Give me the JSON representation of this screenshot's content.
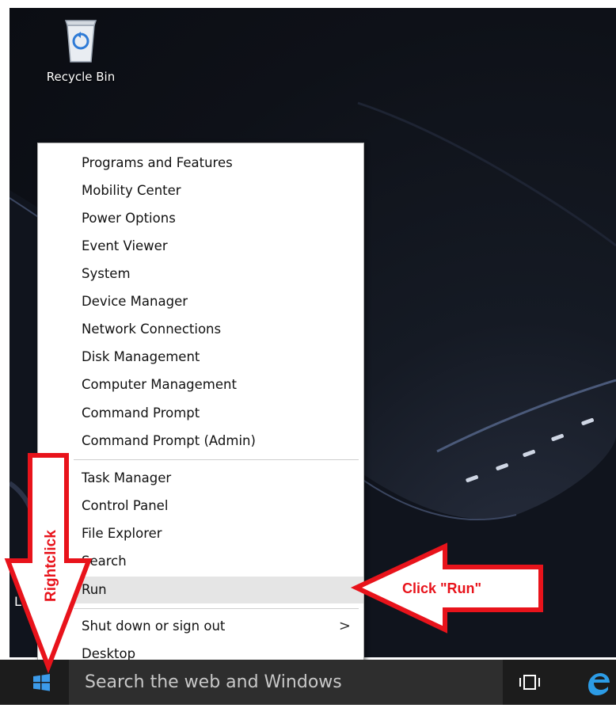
{
  "desktop": {
    "recycle_bin_label": "Recycle Bin",
    "partial_label": "Lo"
  },
  "context_menu": {
    "items": [
      "Programs and Features",
      "Mobility Center",
      "Power Options",
      "Event Viewer",
      "System",
      "Device Manager",
      "Network Connections",
      "Disk Management",
      "Computer Management",
      "Command Prompt",
      "Command Prompt (Admin)",
      "Task Manager",
      "Control Panel",
      "File Explorer",
      "Search",
      "Run",
      "Shut down or sign out",
      "Desktop"
    ],
    "highlighted_item": "Run",
    "submenu_arrow": ">"
  },
  "taskbar": {
    "search_placeholder": "Search the web and Windows"
  },
  "annotations": {
    "rightclick_label": "Rightclick",
    "click_run_label": "Click \"Run\"",
    "arrow_color": "#e8131b"
  },
  "icons": {
    "start": "windows-logo-icon",
    "task_view": "task-view-icon",
    "browser": "edge-icon",
    "recycle_bin": "recycle-bin-icon"
  }
}
